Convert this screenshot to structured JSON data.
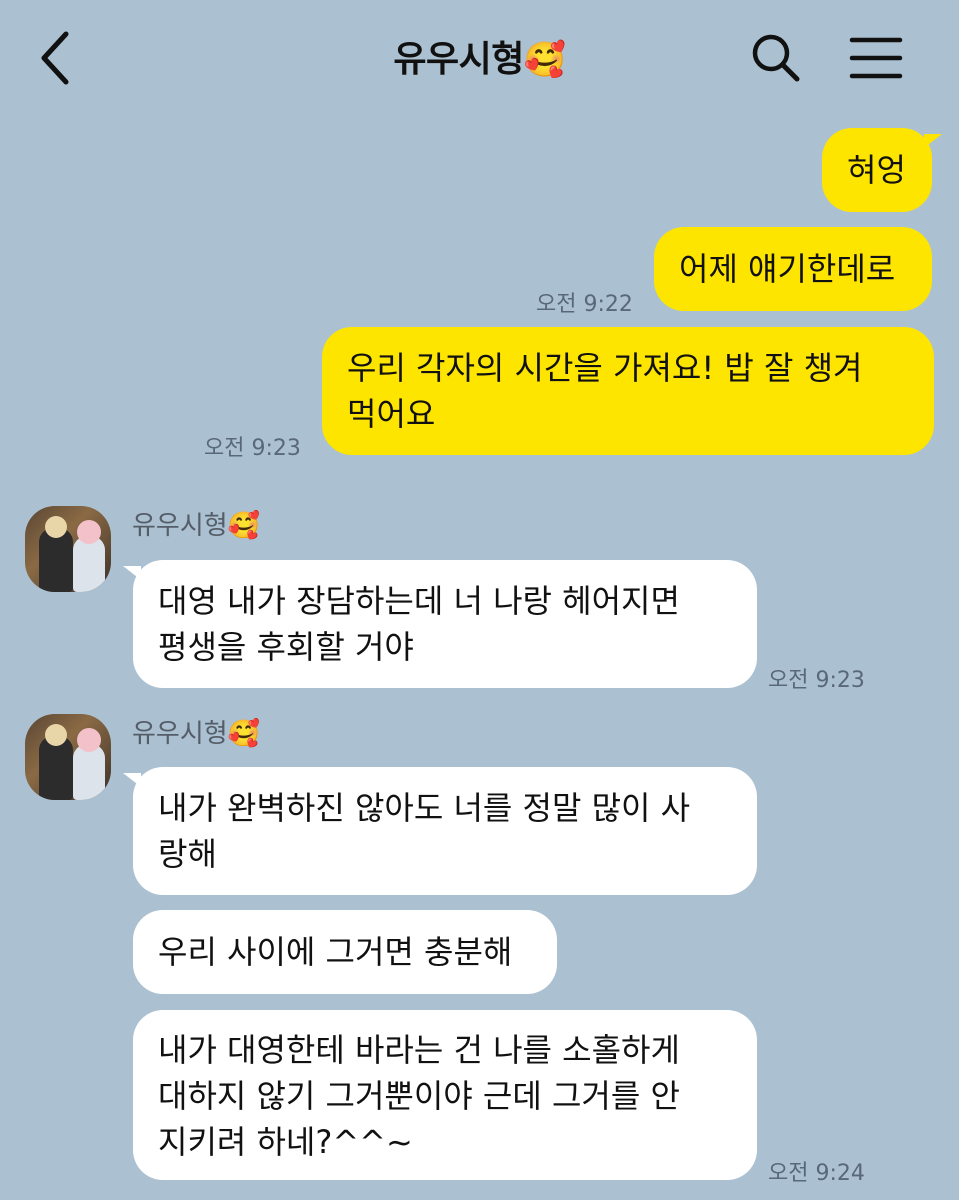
{
  "header": {
    "title": "유우시형",
    "title_emoji": "🥰"
  },
  "icons": {
    "back": "chevron-left-icon",
    "search": "search-icon",
    "menu": "hamburger-menu-icon"
  },
  "colors": {
    "background": "#abc1d1",
    "outgoing_bubble": "#fee500",
    "incoming_bubble": "#ffffff"
  },
  "messages": {
    "out1": "혀엉",
    "out2": "어제 얘기한데로",
    "out2_time": "오전 9:22",
    "out3_line1": "우리 각자의 시간을 가져요! 밥 잘 챙겨",
    "out3_line2": "먹어요",
    "out3_time": "오전 9:23",
    "group1_sender": "유우시형",
    "group1_sender_emoji": "🥰",
    "in1_line1": "대영 내가 장담하는데 너 나랑 헤어지면",
    "in1_line2": "평생을 후회할 거야",
    "in1_time": "오전 9:23",
    "group2_sender": "유우시형",
    "group2_sender_emoji": "🥰",
    "in2_line1": "내가 완벽하진 않아도 너를 정말 많이 사",
    "in2_line2": "랑해",
    "in3": "우리 사이에 그거면 충분해",
    "in4_line1": "내가 대영한테 바라는 건 나를 소홀하게",
    "in4_line2": "대하지 않기 그거뿐이야 근데 그거를 안",
    "in4_line3": "지키려 하네?^^~",
    "in4_time": "오전 9:24"
  }
}
